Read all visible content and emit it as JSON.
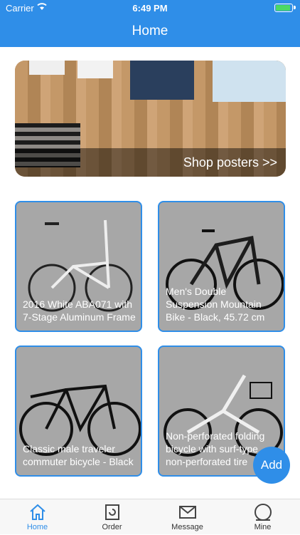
{
  "status_bar": {
    "carrier": "Carrier",
    "time": "6:49 PM"
  },
  "nav": {
    "title": "Home"
  },
  "banner": {
    "cta_label": "Shop posters >>"
  },
  "products": [
    {
      "title": "2016 White ABA071 with 7-Stage Aluminum Frame"
    },
    {
      "title": "Men's Double Suspension Mountain Bike - Black, 45.72 cm"
    },
    {
      "title": "Classic male traveler commuter bicycle - Black"
    },
    {
      "title": "Non-perforated folding bicycle with surf-type non-perforated tire"
    }
  ],
  "fab": {
    "label": "Add"
  },
  "tabs": [
    {
      "label": "Home",
      "icon": "home-icon",
      "active": true
    },
    {
      "label": "Order",
      "icon": "order-icon"
    },
    {
      "label": "Message",
      "icon": "mail-icon"
    },
    {
      "label": "Mine",
      "icon": "user-icon"
    }
  ],
  "colors": {
    "accent": "#2f8ee8"
  }
}
